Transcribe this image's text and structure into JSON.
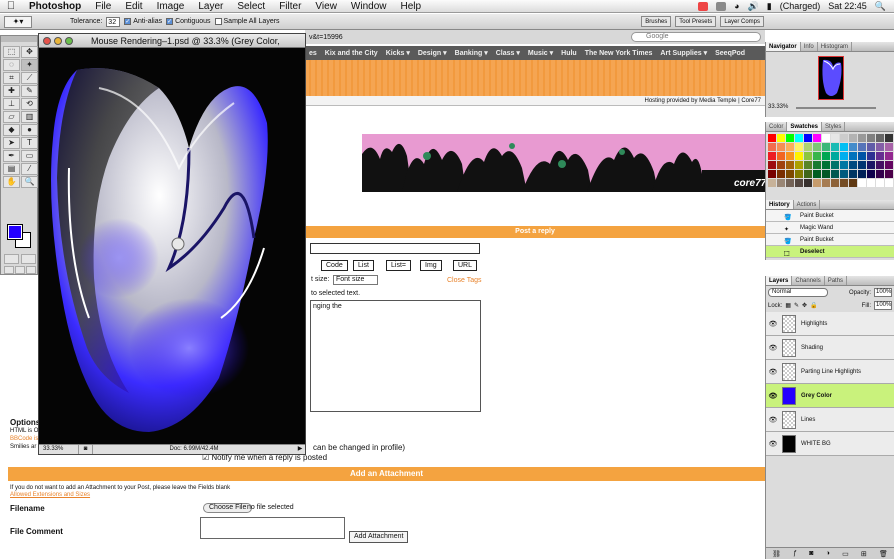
{
  "menubar": {
    "app_name": "Photoshop",
    "items": [
      "File",
      "Edit",
      "Image",
      "Layer",
      "Select",
      "Filter",
      "View",
      "Window",
      "Help"
    ],
    "battery": "(Charged)",
    "clock": "Sat 22:45"
  },
  "options_bar": {
    "tolerance_label": "Tolerance:",
    "tolerance_value": "32",
    "anti_alias": "Anti-alias",
    "contiguous": "Contiguous",
    "sample_all": "Sample All Layers",
    "wells": [
      "Brushes",
      "Tool Presets",
      "Layer Comps"
    ]
  },
  "browser": {
    "url": "v&t=15996",
    "search_placeholder": "Google",
    "bookmarks": [
      "es",
      "Kix and the City",
      "Kicks ▾",
      "Design ▾",
      "Banking ▾",
      "Class ▾",
      "Music ▾",
      "Hulu",
      "The New York Times",
      "Art Supplies ▾",
      "SeeqPod"
    ],
    "hosting": "Hosting provided by Media Temple | Core77"
  },
  "forum": {
    "post_reply": "Post a reply",
    "format_buttons": [
      "Code",
      "List",
      "List=",
      "Img",
      "URL"
    ],
    "font_size_label": "t size:",
    "font_size_value": "Font size",
    "close_tags": "Close Tags",
    "tip": "to selected text.",
    "message_text": "nging the",
    "options_title": "Options",
    "options_lines": [
      "HTML is O",
      "BBCode is",
      "Smilies ar"
    ],
    "changed_note": "can be changed in profile)",
    "notify": "Notify me when a reply is posted",
    "attach_header": "Add an Attachment",
    "attach_note": "If you do not want to add an Attachment to your Post, please leave the Fields blank",
    "allowed_link": "Allowed Extensions and Sizes",
    "filename_label": "Filename",
    "choose_file": "Choose File",
    "no_file": "no file selected",
    "file_comment_label": "File Comment",
    "add_attachment": "Add Attachment"
  },
  "document": {
    "title": "Mouse Rendering–1.psd @ 33.3% (Grey Color, RGB/8)",
    "zoom": "33.33%",
    "doc_size": "Doc: 6.99M/42.4M"
  },
  "toolbox": {
    "fg_color": "#2400ff",
    "bg_color": "#ffffff"
  },
  "navigator": {
    "tabs": [
      "Navigator",
      "Info",
      "Histogram"
    ],
    "zoom": "33.33%"
  },
  "swatches": {
    "tabs": [
      "Color",
      "Swatches",
      "Styles"
    ],
    "colors": [
      "#ff0000",
      "#ffff00",
      "#00ff00",
      "#00ffff",
      "#0000ff",
      "#ff00ff",
      "#ffffff",
      "#e6e6e6",
      "#cccccc",
      "#b3b3b3",
      "#999999",
      "#808080",
      "#666666",
      "#333333",
      "#f26c4f",
      "#f68e55",
      "#fbaf5c",
      "#fff467",
      "#acd372",
      "#7cc576",
      "#3bb878",
      "#1abbb4",
      "#00bff3",
      "#438ccb",
      "#5574b9",
      "#605ca8",
      "#855fa8",
      "#a763a8",
      "#ed1c24",
      "#f26522",
      "#f7941d",
      "#fff200",
      "#8dc63f",
      "#39b54a",
      "#00a651",
      "#00a99d",
      "#00aeef",
      "#0072bc",
      "#0054a6",
      "#2e3192",
      "#662d91",
      "#92278f",
      "#9e0b0f",
      "#a0410d",
      "#a36209",
      "#aba000",
      "#598527",
      "#1a7b30",
      "#007236",
      "#00746b",
      "#0076a3",
      "#004a80",
      "#003471",
      "#1b1464",
      "#440e62",
      "#630460",
      "#790000",
      "#7b2e00",
      "#7d4900",
      "#827b00",
      "#406618",
      "#005e20",
      "#005826",
      "#005952",
      "#005b7f",
      "#003663",
      "#002157",
      "#0d004c",
      "#32004b",
      "#4b0049",
      "#c7b299",
      "#998675",
      "#736357",
      "#534741",
      "#37302d",
      "#c69c6d",
      "#a67c52",
      "#8c6239",
      "#754c24",
      "#603913",
      "#ffffff",
      "#ffffff",
      "#ffffff",
      "#ffffff"
    ]
  },
  "history": {
    "tabs": [
      "History",
      "Actions"
    ],
    "items": [
      "Paint Bucket",
      "Magic Wand",
      "Paint Bucket",
      "Deselect"
    ]
  },
  "layers": {
    "tabs": [
      "Layers",
      "Channels",
      "Paths"
    ],
    "blend": "Normal",
    "opacity_label": "Opacity:",
    "opacity": "100%",
    "lock_label": "Lock:",
    "fill_label": "Fill:",
    "fill": "100%",
    "items": [
      "Highlights",
      "Shading",
      "Parting Line Highlights",
      "Grey Color",
      "Lines",
      "WHITE BG"
    ]
  }
}
